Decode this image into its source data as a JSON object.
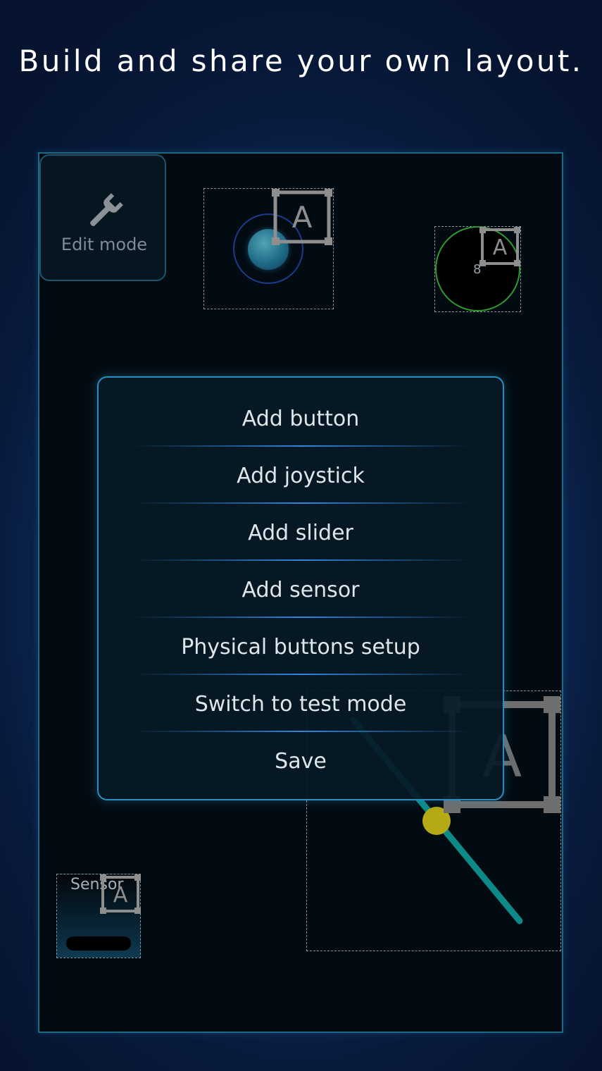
{
  "headline": "Build and share your own layout.",
  "edit_mode": {
    "label": "Edit mode",
    "icon": "wrench-icon"
  },
  "widgets": {
    "joystick": {
      "tag_letter": "A"
    },
    "button": {
      "tag_letter": "A",
      "number": "8"
    },
    "slider": {
      "tag_letter": "A"
    },
    "sensor": {
      "tag_letter": "A",
      "label": "Sensor"
    }
  },
  "menu": {
    "items": [
      {
        "label": "Add button"
      },
      {
        "label": "Add joystick"
      },
      {
        "label": "Add slider"
      },
      {
        "label": "Add sensor"
      },
      {
        "label": "Physical buttons setup"
      },
      {
        "label": "Switch to test mode"
      },
      {
        "label": "Save"
      }
    ]
  },
  "colors": {
    "background": "#0e2e63",
    "canvas": "#030b12",
    "canvas_border": "#1e6a86",
    "menu_border": "#2a8fbf",
    "button_ring": "#2f9a30",
    "slider_track": "#0d8a88",
    "slider_thumb": "#b5a915"
  }
}
